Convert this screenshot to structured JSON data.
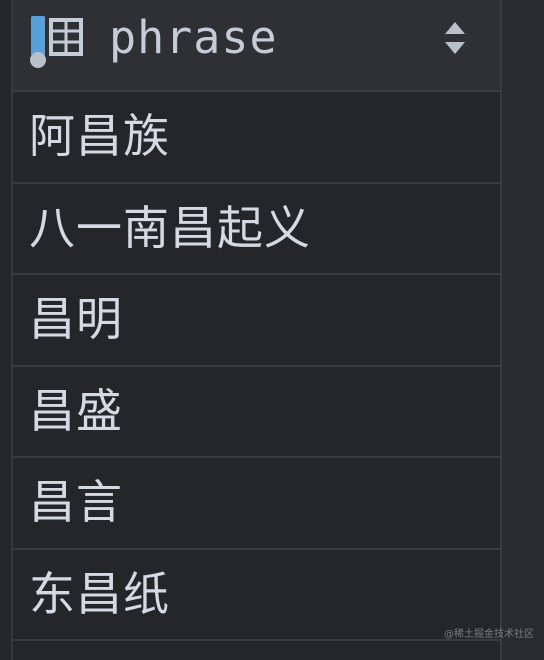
{
  "column": {
    "title": "phrase",
    "icon": "table-column-icon",
    "sort_icon": "sort-updown-icon"
  },
  "rows": [
    {
      "value": "阿昌族"
    },
    {
      "value": "八一南昌起义"
    },
    {
      "value": "昌明"
    },
    {
      "value": "昌盛"
    },
    {
      "value": "昌言"
    },
    {
      "value": "东昌纸"
    }
  ],
  "watermark": "@稀土掘金技术社区",
  "colors": {
    "background": "#252629",
    "header": "#2f3033",
    "text": "#d4dae3",
    "icon_blue": "#5aa0d8",
    "grid_line": "#3a3c40"
  }
}
